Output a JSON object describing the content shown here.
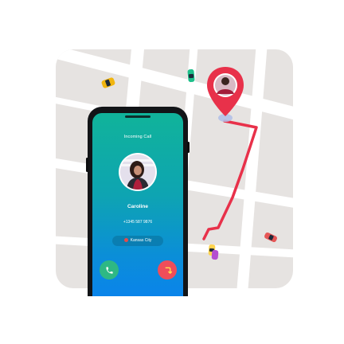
{
  "call_screen": {
    "status": "Incoming Call",
    "caller_name": "Caroline",
    "caller_number": "+1345 587 9876",
    "caller_location": "Kansas City",
    "accept_action": "phone-icon",
    "decline_action": "phone-hangup-icon"
  },
  "map": {
    "route_color": "#e8314a",
    "pin_color": "#e8314a",
    "icons": [
      "car-icon",
      "car-icon",
      "car-icon",
      "car-icon",
      "car-icon",
      "map-pin-icon"
    ]
  },
  "colors": {
    "screen_gradient_top": "#10b39a",
    "screen_gradient_bottom": "#0a84ea",
    "accept": "#2eb884",
    "decline": "#ef4d5a",
    "map_background": "#e6e3e1",
    "road": "#ffffff"
  }
}
